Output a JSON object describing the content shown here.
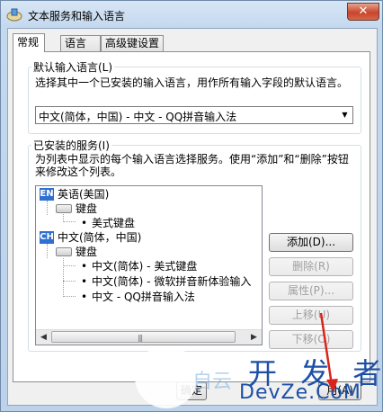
{
  "window": {
    "title": "文本服务和输入语言",
    "close_label": "✕"
  },
  "tabs": [
    {
      "label": "常规"
    },
    {
      "label": "语言栏"
    },
    {
      "label": "高级键设置"
    }
  ],
  "default_language": {
    "title": "默认输入语言(L)",
    "description": "选择其中一个已安装的输入语言，用作所有输入字段的默认语言。",
    "selected": "中文(简体，中国) - 中文 - QQ拼音输入法"
  },
  "installed_services": {
    "title": "已安装的服务(I)",
    "description": "为列表中显示的每个输入语言选择服务。使用“添加”和“删除”按钮来修改这个列表。",
    "tree": [
      {
        "badge": "EN",
        "label": "英语(美国)"
      },
      {
        "label": "键盘"
      },
      {
        "label": "美式键盘"
      },
      {
        "badge": "CH",
        "label": "中文(简体，中国)"
      },
      {
        "label": "键盘"
      },
      {
        "label": "中文(简体) - 美式键盘"
      },
      {
        "label": "中文(简体) - 微软拼音新体验输入"
      },
      {
        "label": "中文 - QQ拼音输入法"
      }
    ],
    "scroll_grip": "|||"
  },
  "buttons": {
    "add": "添加(D)...",
    "remove": "删除(R)",
    "properties": "属性(P)...",
    "move_up": "上移(U)",
    "move_down": "下移(O)"
  },
  "footer": {
    "ok_partial": "确定",
    "apply_partial": "用(A)"
  },
  "watermark": {
    "line1": "开 发 者",
    "line2": "DevZe.CoM",
    "ghost": "自云"
  },
  "colors": {
    "lang_badge": "#2f6fd0",
    "annotation_arrow": "#d9231b"
  }
}
